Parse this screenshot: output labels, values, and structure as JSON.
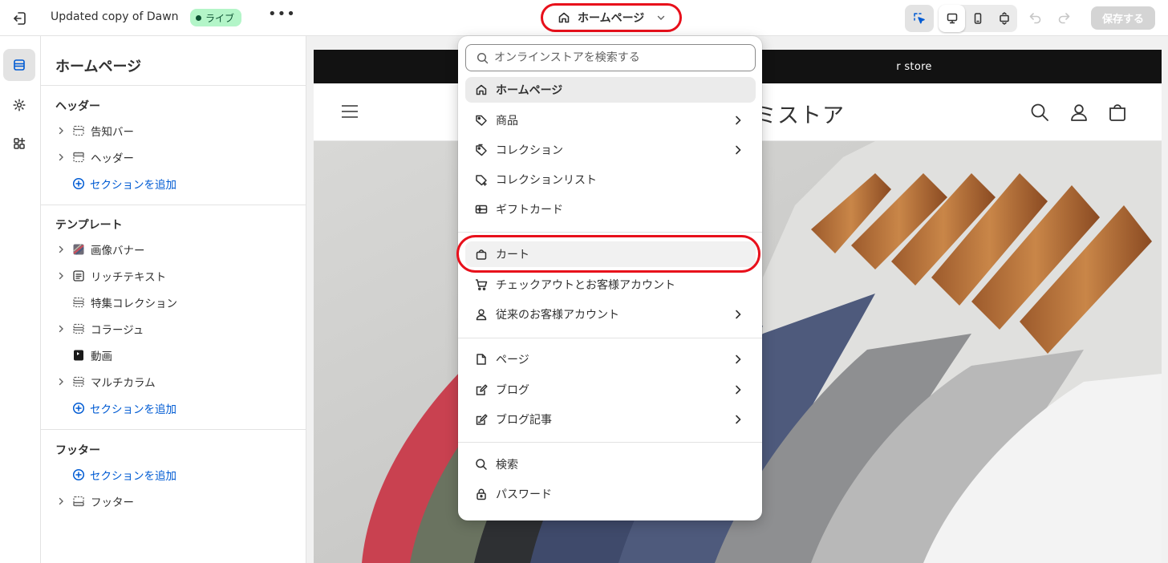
{
  "topbar": {
    "theme_title": "Updated copy of Dawn",
    "status_badge": "ライブ",
    "more_label": "•••",
    "page_selector_label": "ホームページ",
    "save_label": "保存する"
  },
  "sidebar": {
    "title": "ホームページ",
    "groups": {
      "header": {
        "label": "ヘッダー",
        "items": [
          "告知バー",
          "ヘッダー"
        ],
        "add_label": "セクションを追加"
      },
      "template": {
        "label": "テンプレート",
        "items": [
          "画像バナー",
          "リッチテキスト",
          "特集コレクション",
          "コラージュ",
          "動画",
          "マルチカラム"
        ],
        "add_label": "セクションを追加"
      },
      "footer": {
        "label": "フッター",
        "add_label": "セクションを追加",
        "items": [
          "フッター"
        ]
      }
    }
  },
  "preview": {
    "announcement_text": "r store",
    "store_name_fragment": "ミストア"
  },
  "dropdown": {
    "search_placeholder": "オンラインストアを検索する",
    "items": [
      {
        "label": "ホームページ",
        "icon": "home-icon",
        "has_submenu": false,
        "selected": true
      },
      {
        "label": "商品",
        "icon": "tag-icon",
        "has_submenu": true
      },
      {
        "label": "コレクション",
        "icon": "collection-tag-icon",
        "has_submenu": true
      },
      {
        "label": "コレクションリスト",
        "icon": "collection-list-icon",
        "has_submenu": false
      },
      {
        "label": "ギフトカード",
        "icon": "gift-card-icon",
        "has_submenu": false
      },
      {
        "label": "カート",
        "icon": "bag-icon",
        "has_submenu": false
      },
      {
        "label": "チェックアウトとお客様アカウント",
        "icon": "cart-icon",
        "has_submenu": false
      },
      {
        "label": "従来のお客様アカウント",
        "icon": "person-icon",
        "has_submenu": true
      },
      {
        "label": "ページ",
        "icon": "page-icon",
        "has_submenu": true
      },
      {
        "label": "ブログ",
        "icon": "blog-icon",
        "has_submenu": true
      },
      {
        "label": "ブログ記事",
        "icon": "blog-post-icon",
        "has_submenu": true
      },
      {
        "label": "検索",
        "icon": "search-icon",
        "has_submenu": false
      },
      {
        "label": "パスワード",
        "icon": "lock-icon",
        "has_submenu": false
      }
    ]
  },
  "colors": {
    "accent_blue": "#005bd3",
    "live_badge_bg": "#b3f5c8",
    "live_badge_text": "#0c5132",
    "annotation_red": "#e8101b"
  }
}
